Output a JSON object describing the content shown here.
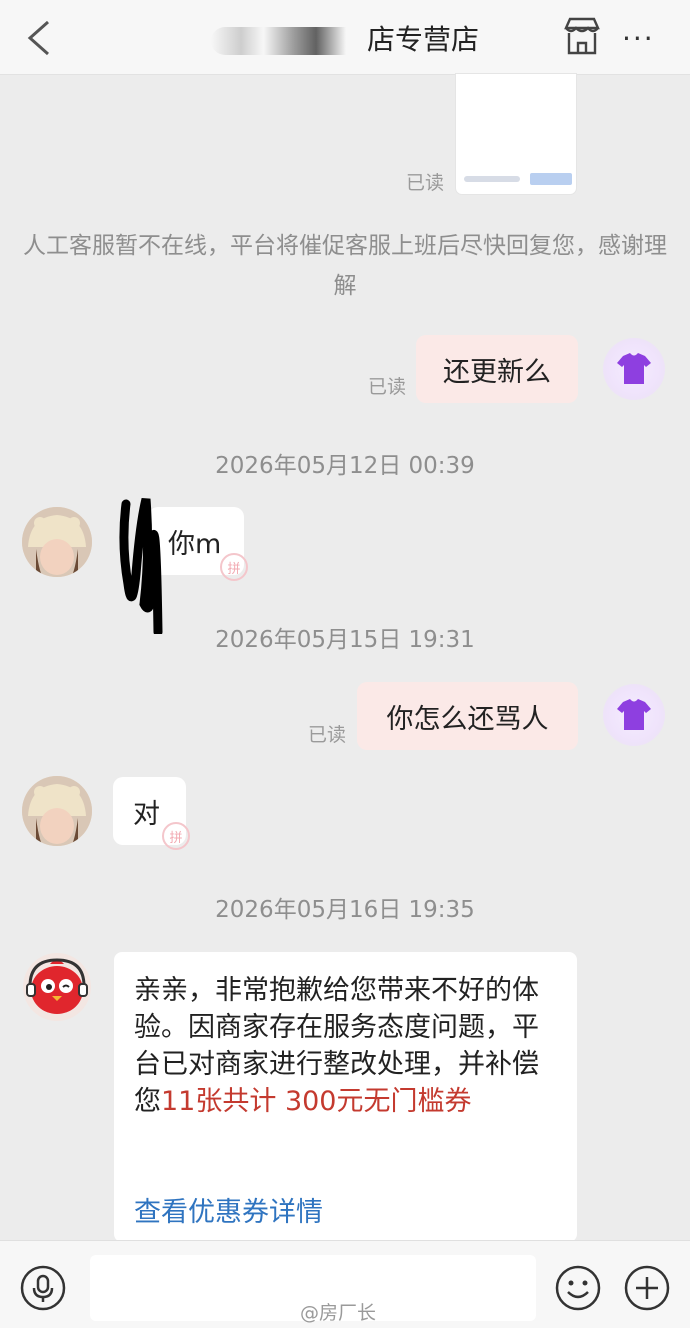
{
  "header": {
    "title_suffix": "店专营店",
    "icons": {
      "back": "chevron-left-icon",
      "store": "store-icon",
      "more": "more-icon"
    },
    "more_label": "···"
  },
  "messages": {
    "read_label": "已读",
    "system_notice": "人工客服暂不在线，平台将催促客服上班后尽快回复您，感谢理解",
    "msg1": "还更新么",
    "ts1": "2026年05月12日 00:39",
    "msg2": "你m",
    "ts2": "2026年05月15日 19:31",
    "msg3": "你怎么还骂人",
    "msg4": "对",
    "ts3": "2026年05月16日 19:35",
    "pin_mark": "拼"
  },
  "compensation": {
    "text_before": "亲亲，非常抱歉给您带来不好的体验。因商家存在服务态度问题，平台已对商家进行整改处理，并补偿您",
    "highlight": "11张共计 300元无门槛券",
    "link": "查看优惠券详情",
    "highlight_color": "#c43a2f",
    "link_color": "#2f74c0"
  },
  "bottom": {
    "watermark": "@房厂长",
    "icons": {
      "mic": "microphone-icon",
      "emoji": "emoji-icon",
      "plus": "plus-icon"
    }
  }
}
